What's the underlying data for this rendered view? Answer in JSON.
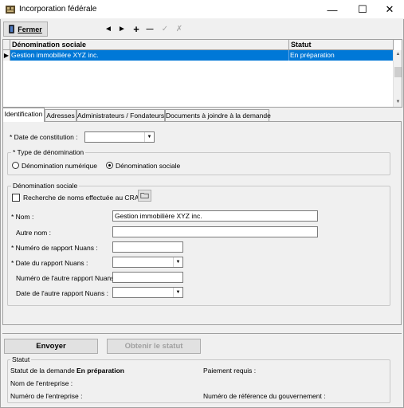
{
  "window": {
    "title": "Incorporation fédérale",
    "minimize": "—",
    "maximize": "☐",
    "close": "✕"
  },
  "toolbar": {
    "close_label": "Fermer",
    "nav_prev": "◄",
    "nav_next": "►",
    "add": "+",
    "remove": "—",
    "accept": "✓",
    "cancel": "✗"
  },
  "grid": {
    "columns": [
      "Dénomination sociale",
      "Statut"
    ],
    "rows": [
      {
        "name": "Gestion immobilière XYZ inc.",
        "status": "En préparation",
        "marker": "▶"
      }
    ]
  },
  "tabs": [
    {
      "label": "Identification",
      "active": true
    },
    {
      "label": "Adresses",
      "active": false
    },
    {
      "label": "Administrateurs / Fondateurs",
      "active": false
    },
    {
      "label": "Documents à joindre à la demande",
      "active": false
    }
  ],
  "identification": {
    "constitution_date_label": "* Date de constitution :",
    "constitution_date_value": "",
    "name_type_group": "* Type de dénomination",
    "radio_numeric": "Dénomination numérique",
    "radio_social": "Dénomination sociale",
    "selected_name_type": "social",
    "social_group": "Dénomination sociale",
    "crac_checkbox_label": "Recherche de noms effectuée au CRAC",
    "crac_checked": false,
    "name_label": "* Nom :",
    "name_value": "Gestion immobilière XYZ inc.",
    "other_name_label": "Autre nom :",
    "other_name_value": "",
    "nuans_number_label": "* Numéro de rapport Nuans :",
    "nuans_number_value": "",
    "nuans_date_label": "* Date du rapport Nuans :",
    "nuans_date_value": "",
    "other_nuans_number_label": "Numéro de l'autre rapport Nuans :",
    "other_nuans_number_value": "",
    "other_nuans_date_label": "Date de l'autre rapport Nuans :",
    "other_nuans_date_value": ""
  },
  "actions": {
    "send": "Envoyer",
    "get_status": "Obtenir le statut"
  },
  "status": {
    "group_title": "Statut",
    "request_status_label": "Statut de la demande :",
    "request_status_value": "En préparation",
    "payment_label": "Paiement requis :",
    "company_name_label": "Nom de l'entreprise :",
    "company_number_label": "Numéro de l'entreprise :",
    "gov_ref_label": "Numéro de référence du gouvernement :"
  },
  "colors": {
    "selection": "#0078d7",
    "window_bg": "#f0f0f0"
  }
}
